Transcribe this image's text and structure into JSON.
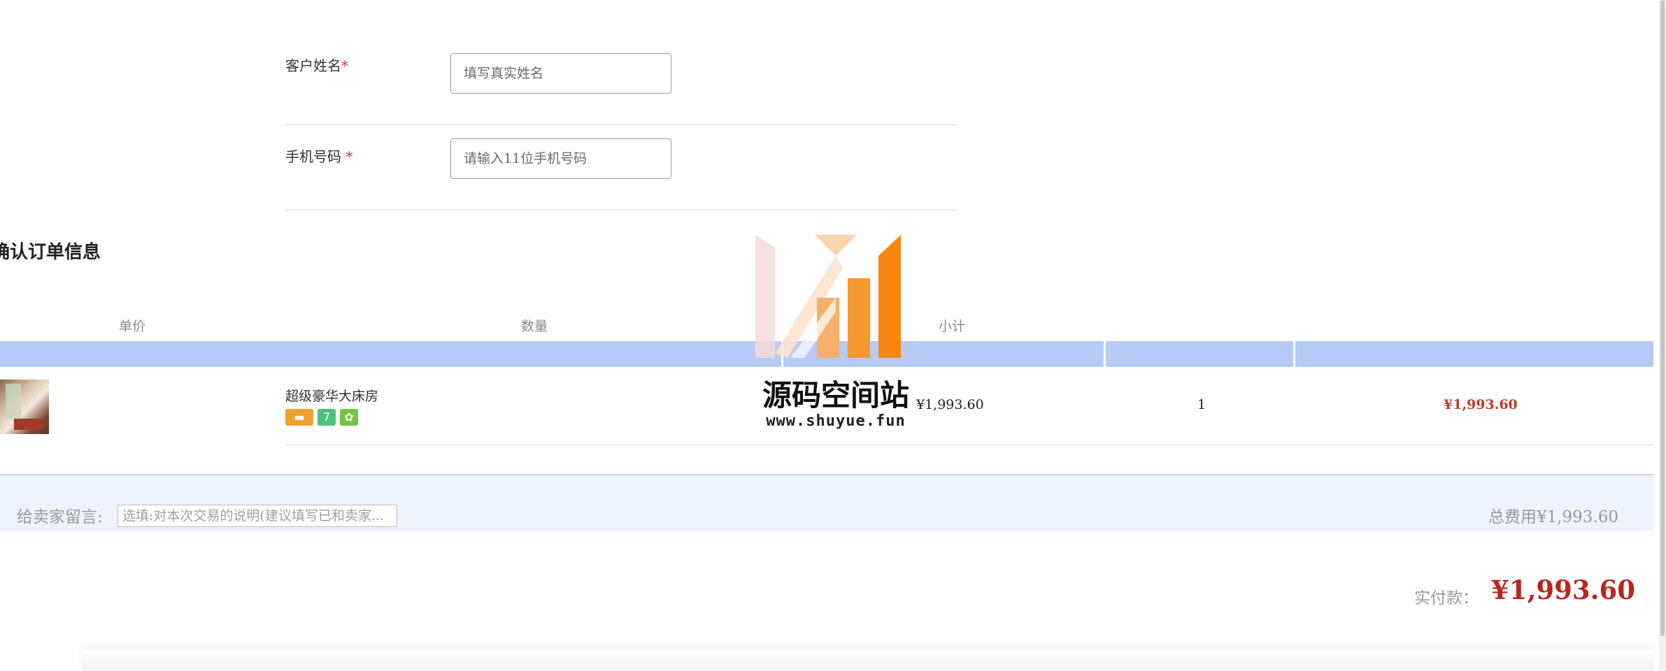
{
  "form": {
    "name_label": "客户姓名",
    "name_required": "*",
    "name_placeholder": "填写真实姓名",
    "phone_label": "手机号码",
    "phone_required": "*",
    "phone_placeholder": "请输入11位手机号码"
  },
  "order": {
    "title": "确认订单信息",
    "headers": {
      "price": "单价",
      "qty": "数量",
      "subtotal": "小计"
    },
    "item": {
      "name": "超级豪华大床房",
      "price": "¥1,993.60",
      "qty": "1",
      "subtotal": "¥1,993.60",
      "icons": [
        "card-icon",
        "seven-icon",
        "food-icon"
      ]
    }
  },
  "message": {
    "label": "给卖家留言:",
    "placeholder": "选填:对本次交易的说明(建议填写已和卖家...",
    "total_fee": "总费用¥1,993.60"
  },
  "payment": {
    "label": "实付款：",
    "amount": "¥1,993.60"
  },
  "watermark": {
    "title": "源码空间站",
    "url": "www.shuyue.fun"
  },
  "colors": {
    "accent_blue": "#b6cbf5",
    "price_red": "#b8261e",
    "required_red": "#d9302c",
    "brand_orange": "#f7931e"
  }
}
